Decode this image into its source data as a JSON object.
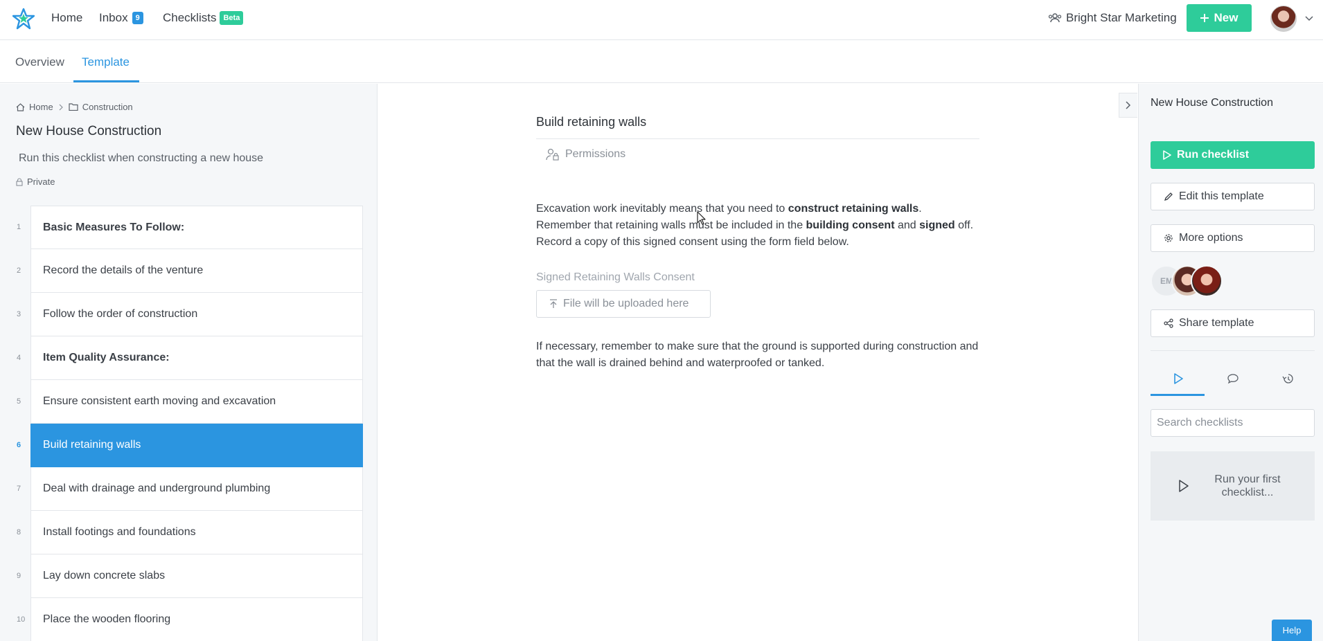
{
  "nav": {
    "home": "Home",
    "inbox": "Inbox",
    "inbox_count": "9",
    "checklists": "Checklists",
    "checklists_badge": "Beta",
    "org": "Bright Star Marketing",
    "new_button": "New"
  },
  "tabs": {
    "overview": "Overview",
    "template": "Template"
  },
  "breadcrumb": {
    "home": "Home",
    "folder": "Construction"
  },
  "template": {
    "title": "New House Construction",
    "description": "Run this checklist when constructing a new house",
    "visibility": "Private"
  },
  "tasks": [
    {
      "num": "1",
      "label": "Basic Measures To Follow:"
    },
    {
      "num": "2",
      "label": "Record the details of the venture"
    },
    {
      "num": "3",
      "label": "Follow the order of construction"
    },
    {
      "num": "4",
      "label": "Item Quality Assurance:"
    },
    {
      "num": "5",
      "label": "Ensure consistent earth moving and excavation"
    },
    {
      "num": "6",
      "label": "Build retaining walls"
    },
    {
      "num": "7",
      "label": "Deal with drainage and underground plumbing"
    },
    {
      "num": "8",
      "label": "Install footings and foundations"
    },
    {
      "num": "9",
      "label": "Lay down concrete slabs"
    },
    {
      "num": "10",
      "label": "Place the wooden flooring"
    }
  ],
  "task": {
    "title": "Build retaining walls",
    "permissions": "Permissions",
    "para1": {
      "t1": "Excavation work inevitably means that you need to ",
      "b1": "construct retaining walls",
      "t2": ". Remember that retaining walls must be included in the ",
      "b2": "building consent",
      "t3": " and ",
      "b3": "signed",
      "t4": " off. Record a copy of this signed consent using the form field below."
    },
    "field_label": "Signed Retaining Walls Consent",
    "upload_text": "File will be uploaded here",
    "para2": "If necessary, remember to make sure that the ground is supported during construction and that the wall is drained behind and waterproofed or tanked."
  },
  "right": {
    "title": "New House Construction",
    "run": "Run checklist",
    "edit": "Edit this template",
    "more": "More options",
    "avatar_initials": "EM",
    "share": "Share template",
    "search_placeholder": "Search checklists",
    "empty": "Run your first checklist..."
  },
  "help": "Help",
  "colors": {
    "accent": "#2b95e0",
    "success": "#2ecc9a"
  },
  "icons": [
    "star-logo-icon",
    "users-icon",
    "plus-icon",
    "chevron-down-icon",
    "home-icon",
    "chevron-right-icon",
    "folder-icon",
    "lock-icon",
    "user-lock-icon",
    "upload-icon",
    "play-icon",
    "pencil-icon",
    "gear-icon",
    "share-icon",
    "comment-icon",
    "history-icon"
  ]
}
